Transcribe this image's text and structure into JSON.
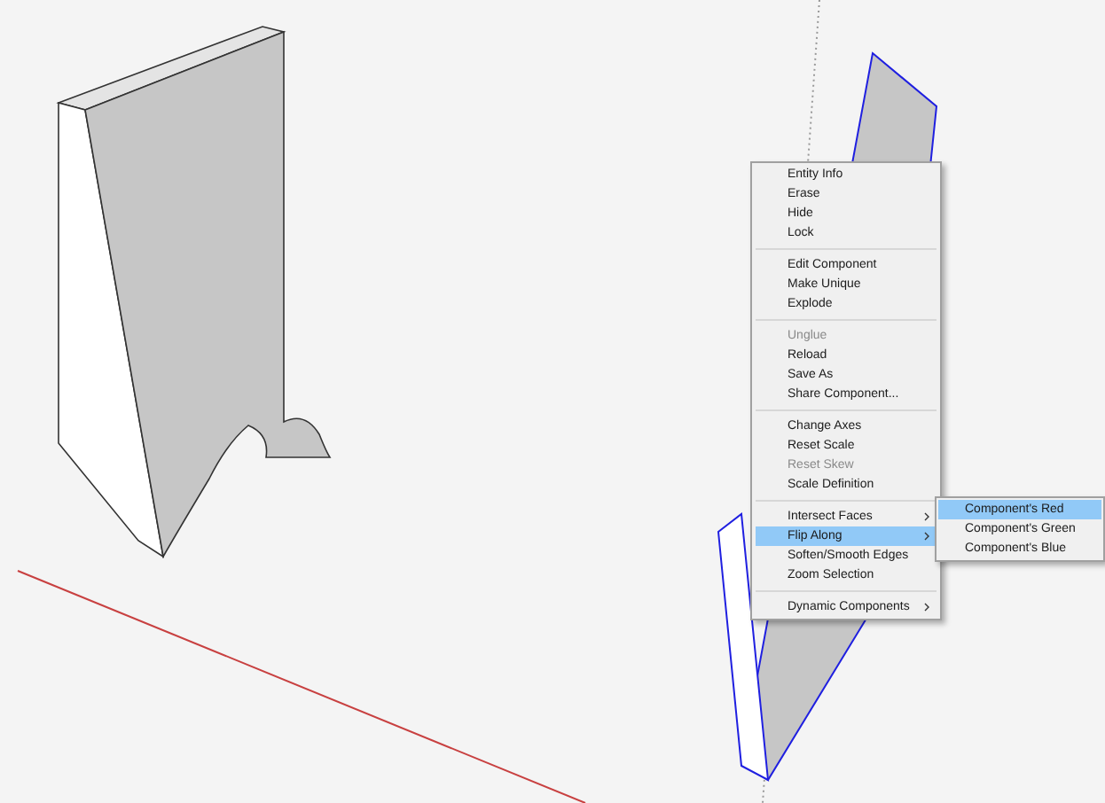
{
  "context_menu": {
    "sections": [
      {
        "items": [
          {
            "label": "Entity Info",
            "disabled": false,
            "selected": false,
            "has_submenu": false
          },
          {
            "label": "Erase",
            "disabled": false,
            "selected": false,
            "has_submenu": false
          },
          {
            "label": "Hide",
            "disabled": false,
            "selected": false,
            "has_submenu": false
          },
          {
            "label": "Lock",
            "disabled": false,
            "selected": false,
            "has_submenu": false
          }
        ]
      },
      {
        "items": [
          {
            "label": "Edit Component",
            "disabled": false,
            "selected": false,
            "has_submenu": false
          },
          {
            "label": "Make Unique",
            "disabled": false,
            "selected": false,
            "has_submenu": false
          },
          {
            "label": "Explode",
            "disabled": false,
            "selected": false,
            "has_submenu": false
          }
        ]
      },
      {
        "items": [
          {
            "label": "Unglue",
            "disabled": true,
            "selected": false,
            "has_submenu": false
          },
          {
            "label": "Reload",
            "disabled": false,
            "selected": false,
            "has_submenu": false
          },
          {
            "label": "Save As",
            "disabled": false,
            "selected": false,
            "has_submenu": false
          },
          {
            "label": "Share Component...",
            "disabled": false,
            "selected": false,
            "has_submenu": false
          }
        ]
      },
      {
        "items": [
          {
            "label": "Change Axes",
            "disabled": false,
            "selected": false,
            "has_submenu": false
          },
          {
            "label": "Reset Scale",
            "disabled": false,
            "selected": false,
            "has_submenu": false
          },
          {
            "label": "Reset Skew",
            "disabled": true,
            "selected": false,
            "has_submenu": false
          },
          {
            "label": "Scale Definition",
            "disabled": false,
            "selected": false,
            "has_submenu": false
          }
        ]
      },
      {
        "items": [
          {
            "label": "Intersect Faces",
            "disabled": false,
            "selected": false,
            "has_submenu": true
          },
          {
            "label": "Flip Along",
            "disabled": false,
            "selected": true,
            "has_submenu": true
          },
          {
            "label": "Soften/Smooth Edges",
            "disabled": false,
            "selected": false,
            "has_submenu": false
          },
          {
            "label": "Zoom Selection",
            "disabled": false,
            "selected": false,
            "has_submenu": false
          }
        ]
      },
      {
        "items": [
          {
            "label": "Dynamic Components",
            "disabled": false,
            "selected": false,
            "has_submenu": true
          }
        ]
      }
    ]
  },
  "submenu": {
    "items": [
      {
        "label": "Component's Red",
        "selected": true
      },
      {
        "label": "Component's Green",
        "selected": false
      },
      {
        "label": "Component's Blue",
        "selected": false
      }
    ]
  }
}
